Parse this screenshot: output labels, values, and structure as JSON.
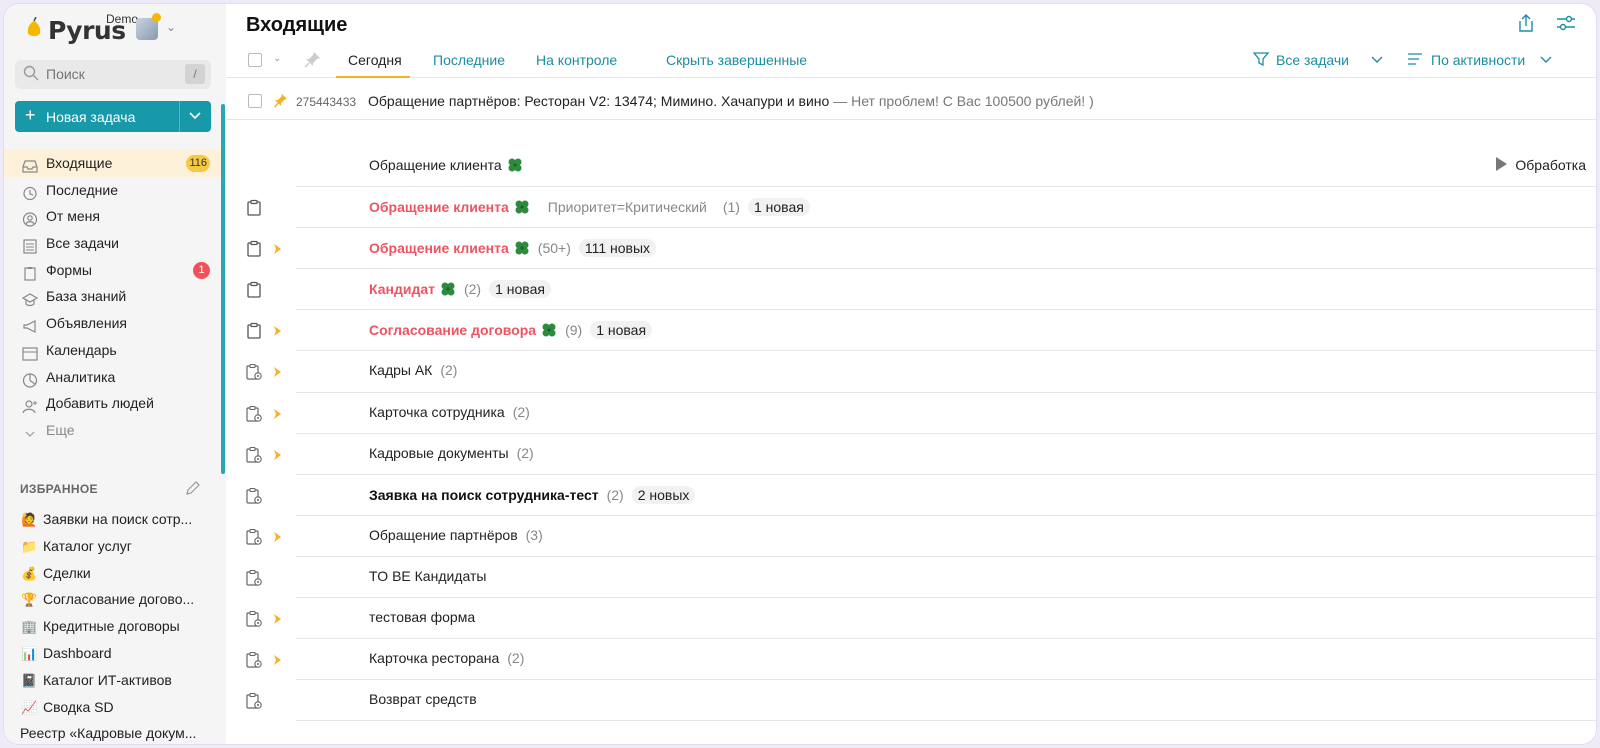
{
  "brand": {
    "logo_text": "Pyrus",
    "env_label": "Demo"
  },
  "search": {
    "placeholder": "Поиск",
    "shortcut": "/"
  },
  "new_task": {
    "label": "Новая задача"
  },
  "nav": [
    {
      "label": "Входящие",
      "icon": "inbox-icon",
      "badge": "116",
      "badge_color": "#f7c842",
      "active": true
    },
    {
      "label": "Последние",
      "icon": "history-icon"
    },
    {
      "label": "От меня",
      "icon": "user-circle-icon"
    },
    {
      "label": "Все задачи",
      "icon": "list-icon"
    },
    {
      "label": "Формы",
      "icon": "clipboard-icon",
      "badge": "1",
      "badge_color": "#f2515b"
    },
    {
      "label": "База знаний",
      "icon": "graduation-cap-icon"
    },
    {
      "label": "Объявления",
      "icon": "megaphone-icon"
    },
    {
      "label": "Календарь",
      "icon": "calendar-icon"
    },
    {
      "label": "Аналитика",
      "icon": "pie-chart-icon"
    },
    {
      "label": "Добавить людей",
      "icon": "add-user-icon"
    },
    {
      "label": "Еще",
      "icon": "chevron-down-icon"
    }
  ],
  "favorites": {
    "header": "ИЗБРАННОЕ",
    "items": [
      {
        "label": "Заявки на поиск сотр...",
        "icon": "person-raising-hand-emoji"
      },
      {
        "label": "Каталог услуг",
        "icon": "folder-emoji"
      },
      {
        "label": "Сделки",
        "icon": "money-bag-emoji"
      },
      {
        "label": "Согласование догово...",
        "icon": "trophy-emoji"
      },
      {
        "label": "Кредитные договоры",
        "icon": "office-building-emoji"
      },
      {
        "label": "Dashboard",
        "icon": "bar-chart-emoji"
      },
      {
        "label": "Каталог ИТ-активов",
        "icon": "notebook-emoji"
      },
      {
        "label": "Сводка SD",
        "icon": "chart-increasing-emoji"
      },
      {
        "label": "Реестр «Кадровые докум...",
        "icon": ""
      }
    ]
  },
  "main": {
    "title": "Входящие",
    "tabs": [
      "Сегодня",
      "Последние",
      "На контроле",
      "Скрыть завершенные"
    ],
    "active_tab": "Сегодня",
    "filter_label": "Все задачи",
    "sort_label": "По активности"
  },
  "pinned": {
    "id": "275443433",
    "title": "Обращение партнёров: Ресторан V2: 13474; Мимино. Хачапури и вино",
    "comment": " — Нет проблем! С Вас 100500 рублей! )"
  },
  "group_header": {
    "title": "Обращение клиента",
    "status": "Обработка"
  },
  "rows": [
    {
      "title": "Обращение клиента",
      "style": "red",
      "clover": true,
      "extra": "Приоритет=Критический",
      "count": "(1)",
      "pill": "1 новая",
      "icon": "clipboard",
      "chev": false
    },
    {
      "title": "Обращение клиента",
      "style": "red",
      "clover": true,
      "extra": "",
      "count": "(50+)",
      "pill": "111 новых",
      "icon": "clipboard",
      "chev": true
    },
    {
      "title": "Кандидат",
      "style": "red",
      "clover": true,
      "extra": "",
      "count": "(2)",
      "pill": "1 новая",
      "icon": "clipboard",
      "chev": false
    },
    {
      "title": "Согласование договора",
      "style": "red",
      "clover": true,
      "extra": "",
      "count": "(9)",
      "pill": "1 новая",
      "icon": "clipboard",
      "chev": true
    },
    {
      "title": "Кадры АК",
      "style": "normal",
      "clover": false,
      "extra": "",
      "count": "(2)",
      "pill": "",
      "icon": "form",
      "chev": true
    },
    {
      "title": "Карточка сотрудника",
      "style": "normal",
      "clover": false,
      "extra": "",
      "count": "(2)",
      "pill": "",
      "icon": "form",
      "chev": true
    },
    {
      "title": "Кадровые документы",
      "style": "normal",
      "clover": false,
      "extra": "",
      "count": "(2)",
      "pill": "",
      "icon": "form",
      "chev": true
    },
    {
      "title": "Заявка на поиск сотрудника-тест",
      "style": "bold",
      "clover": false,
      "extra": "",
      "count": "(2)",
      "pill": "2 новых",
      "icon": "form",
      "chev": false
    },
    {
      "title": "Обращение партнёров",
      "style": "normal",
      "clover": false,
      "extra": "",
      "count": "(3)",
      "pill": "",
      "icon": "form",
      "chev": true
    },
    {
      "title": "TO BE Кандидаты",
      "style": "normal",
      "clover": false,
      "extra": "",
      "count": "",
      "pill": "",
      "icon": "form",
      "chev": false
    },
    {
      "title": "тестовая форма",
      "style": "normal",
      "clover": false,
      "extra": "",
      "count": "",
      "pill": "",
      "icon": "form",
      "chev": true
    },
    {
      "title": "Карточка ресторана",
      "style": "normal",
      "clover": false,
      "extra": "",
      "count": "(2)",
      "pill": "",
      "icon": "form",
      "chev": true
    },
    {
      "title": "Возврат средств",
      "style": "normal",
      "clover": false,
      "extra": "",
      "count": "",
      "pill": "",
      "icon": "form",
      "chev": false
    }
  ],
  "colors": {
    "accent": "#1799a9",
    "highlight": "#f4b224",
    "alert": "#ee5461"
  }
}
